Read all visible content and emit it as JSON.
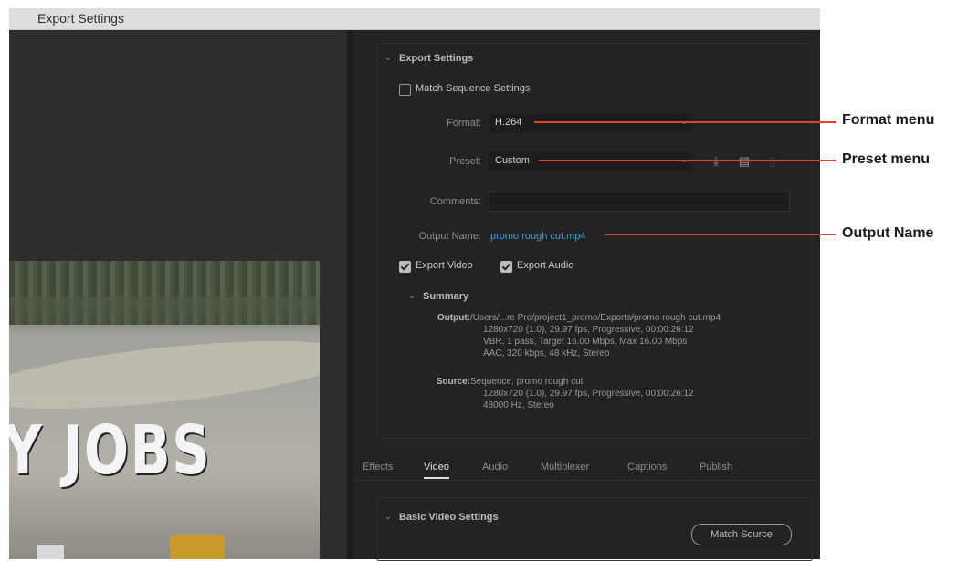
{
  "window": {
    "title": "Export Settings"
  },
  "preview": {
    "overlay_text": "Y JOBS"
  },
  "export_settings": {
    "section_title": "Export Settings",
    "match_sequence_label": "Match Sequence Settings",
    "match_sequence_checked": false,
    "format_label": "Format:",
    "format_value": "H.264",
    "preset_label": "Preset:",
    "preset_value": "Custom",
    "comments_label": "Comments:",
    "comments_value": "",
    "output_name_label": "Output Name:",
    "output_name_value": "promo rough cut.mp4",
    "export_video_label": "Export Video",
    "export_video_checked": true,
    "export_audio_label": "Export Audio",
    "export_audio_checked": true,
    "preset_icons": [
      "save-preset-icon",
      "import-preset-icon",
      "delete-preset-icon"
    ]
  },
  "summary": {
    "title": "Summary",
    "output_label": "Output:",
    "output_lines": [
      "/Users/...re Pro/project1_promo/Exports/promo rough cut.mp4",
      "1280x720 (1.0), 29.97 fps, Progressive, 00:00:26:12",
      "VBR, 1 pass, Target 16.00 Mbps, Max 16.00 Mbps",
      "AAC, 320 kbps, 48 kHz, Stereo"
    ],
    "source_label": "Source:",
    "source_lines": [
      "Sequence, promo rough cut",
      "1280x720 (1.0), 29.97 fps, Progressive, 00:00:26:12",
      "48000 Hz, Stereo"
    ]
  },
  "tabs": [
    {
      "label": "Effects",
      "active": false
    },
    {
      "label": "Video",
      "active": true
    },
    {
      "label": "Audio",
      "active": false
    },
    {
      "label": "Multiplexer",
      "active": false
    },
    {
      "label": "Captions",
      "active": false
    },
    {
      "label": "Publish",
      "active": false
    }
  ],
  "video_settings": {
    "section_title": "Basic Video Settings",
    "match_source_label": "Match Source"
  },
  "callouts": {
    "format": "Format menu",
    "preset": "Preset menu",
    "output_name": "Output Name"
  },
  "colors": {
    "accent_link": "#3f9fe0",
    "callout_line": "#e2442a"
  }
}
